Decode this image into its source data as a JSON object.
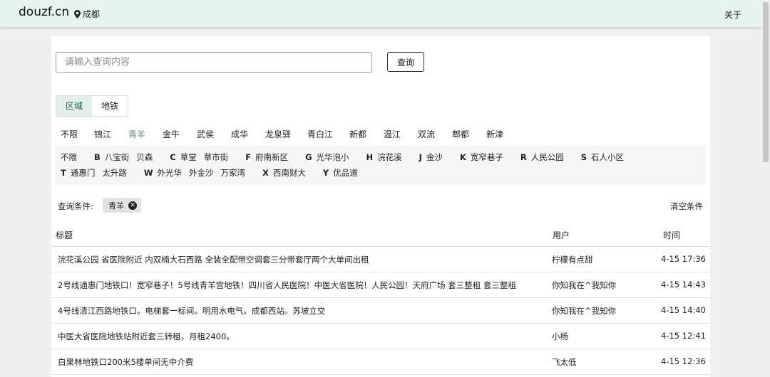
{
  "navbar": {
    "brand": "douzf.cn",
    "city": "成都",
    "about": "关于"
  },
  "search": {
    "placeholder": "请输入查询内容",
    "button": "查询"
  },
  "tabs": [
    {
      "label": "区域",
      "active": true
    },
    {
      "label": "地铁",
      "active": false
    }
  ],
  "regions": [
    {
      "label": "不限",
      "w": 47
    },
    {
      "label": "锦江",
      "w": 48
    },
    {
      "label": "青羊",
      "w": 48,
      "active": true
    },
    {
      "label": "金牛",
      "w": 48
    },
    {
      "label": "武侯",
      "w": 48
    },
    {
      "label": "成华",
      "w": 48
    },
    {
      "label": "龙泉驿",
      "w": 59
    },
    {
      "label": "青白江",
      "w": 59
    },
    {
      "label": "新都",
      "w": 48
    },
    {
      "label": "温江",
      "w": 48
    },
    {
      "label": "双流",
      "w": 48
    },
    {
      "label": "郫都",
      "w": 48
    },
    {
      "label": "新津",
      "w": 30
    }
  ],
  "subway": {
    "row1": [
      {
        "letter": "",
        "stations": [
          "不限"
        ]
      },
      {
        "letter": "B",
        "stations": [
          "八宝街",
          "贝森"
        ]
      },
      {
        "letter": "C",
        "stations": [
          "草堂",
          "草市街"
        ]
      },
      {
        "letter": "F",
        "stations": [
          "府南新区"
        ]
      },
      {
        "letter": "G",
        "stations": [
          "光华泡小"
        ]
      },
      {
        "letter": "H",
        "stations": [
          "浣花溪"
        ]
      },
      {
        "letter": "J",
        "stations": [
          "金沙"
        ]
      },
      {
        "letter": "K",
        "stations": [
          "宽窄巷子"
        ]
      },
      {
        "letter": "R",
        "stations": [
          "人民公园"
        ]
      },
      {
        "letter": "S",
        "stations": [
          "石人小区"
        ]
      }
    ],
    "row2": [
      {
        "letter": "T",
        "stations": [
          "通惠门",
          "太升路"
        ]
      },
      {
        "letter": "W",
        "stations": [
          "外光华",
          "外金沙",
          "万家湾"
        ]
      },
      {
        "letter": "X",
        "stations": [
          "西南财大"
        ]
      },
      {
        "letter": "Y",
        "stations": [
          "优品道"
        ]
      }
    ]
  },
  "conditions": {
    "label": "查询条件:",
    "chips": [
      "青羊"
    ],
    "clear": "清空条件"
  },
  "table": {
    "headers": {
      "title": "标题",
      "user": "用户",
      "time": "时间"
    },
    "rows": [
      {
        "title": "浣花溪公园 省医院附近 内双楠大石西路 全装全配带空调套三分带套厅两个大单间出租",
        "user": "柠檬有点甜",
        "time": "4-15 17:36"
      },
      {
        "title": "2号线通惠门地铁口！宽窄巷子！5号线青羊宫地铁！四川省人民医院！中医大省医院！人民公园！天府广场 套三整租 套三整租",
        "user": "你知我在^我知你",
        "time": "4-15 14:43"
      },
      {
        "title": "4号线清江西路地铁口。电梯套一标间。明用水电气。成都西站。苏坡立交",
        "user": "你知我在^我知你",
        "time": "4-15 14:40"
      },
      {
        "title": "中医大省医院地铁站附近套三转租，月租2400。",
        "user": "小杨",
        "time": "4-15 12:41"
      },
      {
        "title": "白果林地铁口200米5楼单间无中介费",
        "user": "飞太低",
        "time": "4-15 12:36"
      }
    ]
  }
}
